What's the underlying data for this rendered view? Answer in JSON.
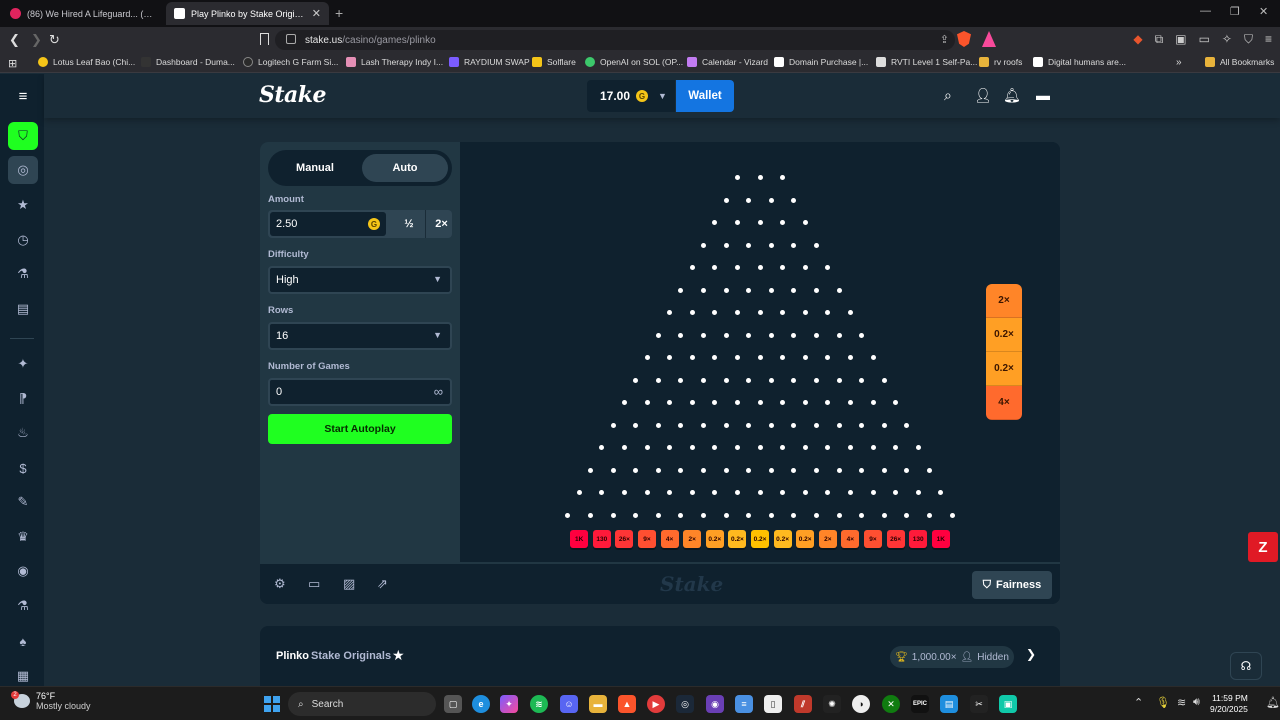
{
  "browser": {
    "tabs": [
      {
        "title": "(86) We Hired A Lifeguard... (Waterp",
        "active": false
      },
      {
        "title": "Play Plinko by Stake Originals Or",
        "active": true
      }
    ],
    "url_host": "stake.us",
    "url_path": "/casino/games/plinko",
    "bookmarks": [
      {
        "label": "Lotus Leaf Bao (Chi...",
        "color": "#f5c518"
      },
      {
        "label": "Dashboard - Duma...",
        "color": "#333333"
      },
      {
        "label": "Logitech G Farm Si...",
        "color": "#2a2a2a"
      },
      {
        "label": "Lash Therapy Indy I...",
        "color": "#e58fb5"
      },
      {
        "label": "RAYDIUM SWAP",
        "color": "#7b5cff"
      },
      {
        "label": "Solflare",
        "color": "#f5c518"
      },
      {
        "label": "OpenAI on SOL (OP...",
        "color": "#3cc86b"
      },
      {
        "label": "Calendar - Vizard",
        "color": "#c27cf2"
      },
      {
        "label": "Domain Purchase |...",
        "color": "#ffffff"
      },
      {
        "label": "RVTI Level 1 Self-Pa...",
        "color": "#dddddd"
      },
      {
        "label": "rv roofs",
        "color": "#e8b33b"
      },
      {
        "label": "Digital humans are...",
        "color": "#ffffff"
      }
    ],
    "all_bookmarks": "All Bookmarks"
  },
  "header": {
    "logo": "Stake",
    "balance": "17.00",
    "coin_letter": "G",
    "wallet_label": "Wallet"
  },
  "controls": {
    "mode_manual": "Manual",
    "mode_auto": "Auto",
    "amount_label": "Amount",
    "amount_value": "2.50",
    "half_label": "½",
    "double_label": "2×",
    "difficulty_label": "Difficulty",
    "difficulty_value": "High",
    "rows_label": "Rows",
    "rows_value": "16",
    "games_label": "Number of Games",
    "games_value": "0",
    "start_label": "Start Autoplay"
  },
  "board": {
    "rows": 16,
    "buckets": [
      "1K",
      "130",
      "26×",
      "9×",
      "4×",
      "2×",
      "0.2×",
      "0.2×",
      "0.2×",
      "0.2×",
      "0.2×",
      "2×",
      "4×",
      "9×",
      "26×",
      "130",
      "1K"
    ],
    "bucket_colors": [
      "#ff003f",
      "#ff1a3a",
      "#ff3536",
      "#ff4f31",
      "#ff6a2d",
      "#ff8528",
      "#ff9f24",
      "#ffb91f",
      "#ffc000",
      "#ffb91f",
      "#ff9f24",
      "#ff8528",
      "#ff6a2d",
      "#ff4f31",
      "#ff3536",
      "#ff1a3a",
      "#ff003f"
    ],
    "history": [
      {
        "label": "2×",
        "color": "#ff8528"
      },
      {
        "label": "0.2×",
        "color": "#ff9f24"
      },
      {
        "label": "0.2×",
        "color": "#ff9f24"
      },
      {
        "label": "4×",
        "color": "#ff6a2d"
      }
    ]
  },
  "footer": {
    "watermark": "Stake",
    "fairness_label": "Fairness"
  },
  "info": {
    "game_name": "Plinko",
    "provider": "Stake Originals",
    "max_win": "1,000.00×",
    "hidden_label": "Hidden"
  },
  "taskbar": {
    "temp": "76°F",
    "weather": "Mostly cloudy",
    "search_label": "Search",
    "time": "11:59 PM",
    "date": "9/20/2025"
  }
}
